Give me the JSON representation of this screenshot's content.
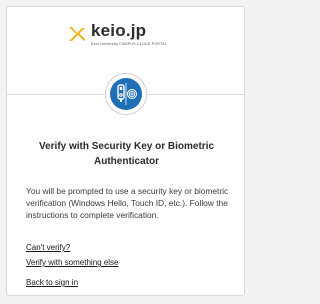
{
  "logo": {
    "name": "keio.jp",
    "subtitle": "Keio University CAMPUS CLOUD PORTAL"
  },
  "auth": {
    "icon": "security-key-biometric-icon",
    "title": "Verify with Security Key or Biometric Authenticator",
    "description": "You will be prompted to use a security key or biometric verification (Windows Hello, Touch ID, etc.). Follow the instructions to complete verification."
  },
  "links": {
    "cant_verify": "Can't verify?",
    "verify_else": "Verify with something else",
    "back_to_sign_in": "Back to sign in"
  },
  "colors": {
    "accent": "#1f6fb8",
    "logo_yellow": "#f5b51f"
  }
}
